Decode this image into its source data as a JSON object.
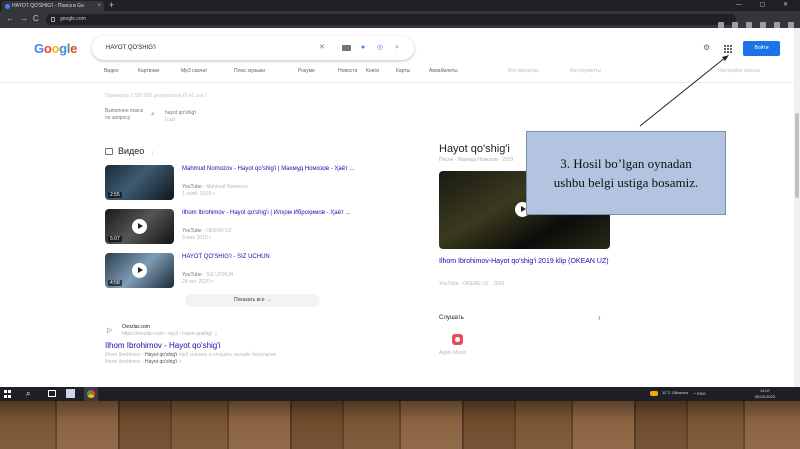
{
  "browser": {
    "tab_title": "HAYOT QO'SHIG'I - Поиск в Go",
    "tab_close": "×",
    "new_tab": "+",
    "window_buttons": "— ▢ ✕",
    "nav_back": "←",
    "nav_forward": "→",
    "nav_reload": "C",
    "url": "google.com"
  },
  "google": {
    "logo_letters": [
      "G",
      "o",
      "o",
      "g",
      "l",
      "e"
    ],
    "logo_colors": [
      "#4285f4",
      "#ea4335",
      "#fbbc05",
      "#4285f4",
      "#34a853",
      "#ea4335"
    ],
    "query": "HAYOT QO'SHIG'I",
    "signin_label": "Войти",
    "tabs": [
      "Видео",
      "Картинки",
      "Mp3 скачат",
      "Плюс музыки",
      "Рокуме",
      "Новости",
      "Книги",
      "Карты",
      "Авиабилеты",
      "Все фильтры",
      "Инструменты"
    ],
    "tools_right": "Настройки поиска"
  },
  "results": {
    "faded_line": "Примерно 1 530 000 результатов (0,41 сек.)",
    "lang_label": "Выполнен поиск по запросу",
    "lang_query": "hayot qo'shig'i",
    "lang_alt": "Ещё",
    "videos_heading": "Видео",
    "videos_info": "⋮",
    "videos": [
      {
        "title": "Mahmud Nomozov - Hayot qo'shig'i | Махмуд Номозов - Ҳаёт ...",
        "source": "YouTube",
        "channel": "Mahmud Nomozov",
        "date": "1 нояб. 2019 г.",
        "duration": "2:55"
      },
      {
        "title": "Ilhom Ibrohimov - Hayot qo'shig'i | Илҳом Иброҳимов - Ҳаёт ...",
        "source": "YouTube",
        "channel": "OKEAN UZ",
        "date": "3 мая 2019 г.",
        "duration": "5:07"
      },
      {
        "title": "HAYOT QO'SHIG'I - SIZ UCHUN",
        "source": "YouTube",
        "channel": "SIZ UCHUN",
        "date": "24 окт. 2020 г.",
        "duration": "4:58"
      }
    ],
    "show_all": "Показать все  →",
    "web_result": {
      "site": "Ovozlar.com",
      "url": "https://ovozlar.com › mp3 › hayot-qoshigi",
      "title": "Ilhom Ibrohimov - Hayot qo'shig'i",
      "snippet_pre": "Ilhom Ibrohimov - ",
      "snippet_bold1": "Hayot qo'shig'i",
      "snippet_mid": " mp3 скачать и слушать онлайн бесплатно",
      "snippet_line2_pre": "Ilhom Ibrohimov - ",
      "snippet_bold2": "Hayot qo'shig'i",
      "snippet_end": " >"
    }
  },
  "knowledge_panel": {
    "title": "Hayot qo'shig'i",
    "subtitle": "Песня · Махмуд Номозов · 2019",
    "video_title": "Ilhom Ibrohimov-Hayot qo'shig'i 2019 klip (OKEAN UZ)",
    "video_meta": "YouTube · OKEAN UZ · 2019",
    "listen_label": "Слушать",
    "listen_chevron": "›",
    "app_name": "Apple Music"
  },
  "callout": {
    "text_line1": "3. Hosil bo’lgan oynadan",
    "text_line2": "ushbu belgi ustiga bosamiz."
  },
  "taskbar": {
    "weather": "11°C Облачно",
    "tray": "^ ENG",
    "time": "14:07",
    "date": "06.03.2023"
  }
}
